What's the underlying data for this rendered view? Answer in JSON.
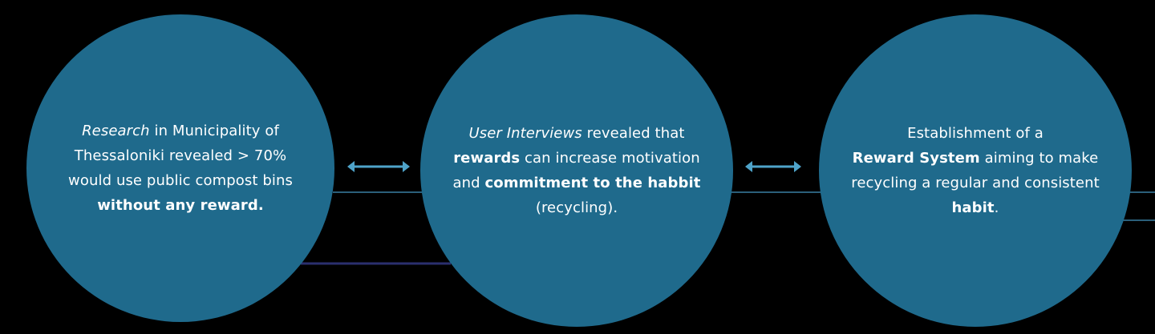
{
  "colors": {
    "background": "#000000",
    "circle_fill": "#1f6a8c",
    "text": "#ffffff",
    "connector_line": "#2b5f7a",
    "connector_line_dark": "#2a2f6e",
    "arrow": "#4ea3c9"
  },
  "circles": [
    {
      "lines": [
        [
          {
            "t": "Research",
            "s": "i"
          },
          {
            "t": " in Municipality of",
            "s": ""
          }
        ],
        [
          {
            "t": "Thessaloniki revealed > 70%",
            "s": ""
          }
        ],
        [
          {
            "t": "would use public compost bins",
            "s": ""
          }
        ],
        [
          {
            "t": "without any reward.",
            "s": "b"
          }
        ]
      ]
    },
    {
      "lines": [
        [
          {
            "t": "User Interviews",
            "s": "i"
          },
          {
            "t": " revealed that",
            "s": ""
          }
        ],
        [
          {
            "t": "rewards",
            "s": "b"
          },
          {
            "t": " can increase motivation",
            "s": ""
          }
        ],
        [
          {
            "t": "and ",
            "s": ""
          },
          {
            "t": "commitment to the habbit",
            "s": "b"
          }
        ],
        [
          {
            "t": "(recycling).",
            "s": ""
          }
        ]
      ]
    },
    {
      "lines": [
        [
          {
            "t": "Establishment of a",
            "s": ""
          }
        ],
        [
          {
            "t": "Reward System",
            "s": "b"
          },
          {
            "t": " aiming to make",
            "s": ""
          }
        ],
        [
          {
            "t": "recycling a regular and consistent",
            "s": ""
          }
        ],
        [
          {
            "t": "habit",
            "s": "b"
          },
          {
            "t": ".",
            "s": ""
          }
        ]
      ]
    }
  ],
  "connectors": [
    {
      "from": "circle-1",
      "to": "circle-2",
      "icon": "double-arrow-icon"
    },
    {
      "from": "circle-2",
      "to": "circle-3",
      "icon": "double-arrow-icon"
    }
  ]
}
